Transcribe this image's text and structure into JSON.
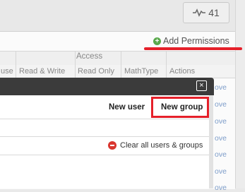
{
  "header": {
    "pulse_count": "41",
    "pulse_icon": "pulse-icon"
  },
  "permissions": {
    "add_label": "Add Permissions",
    "group_header": "Access",
    "columns": [
      "use",
      "Read & Write",
      "Read Only",
      "MathType",
      "Actions"
    ],
    "row_actions": [
      "ove",
      "ove",
      "ove",
      "ove",
      "ove",
      "ove",
      "ove",
      "ove"
    ]
  },
  "modal": {
    "close_icon": "close-icon",
    "new_user_label": "New user",
    "new_group_label": "New group",
    "clear_label": "Clear all users & groups"
  },
  "colors": {
    "highlight": "#e5202a",
    "add_icon": "#5aa94c",
    "link": "#7c9cc9",
    "modal_bar": "#3b3b3b"
  }
}
